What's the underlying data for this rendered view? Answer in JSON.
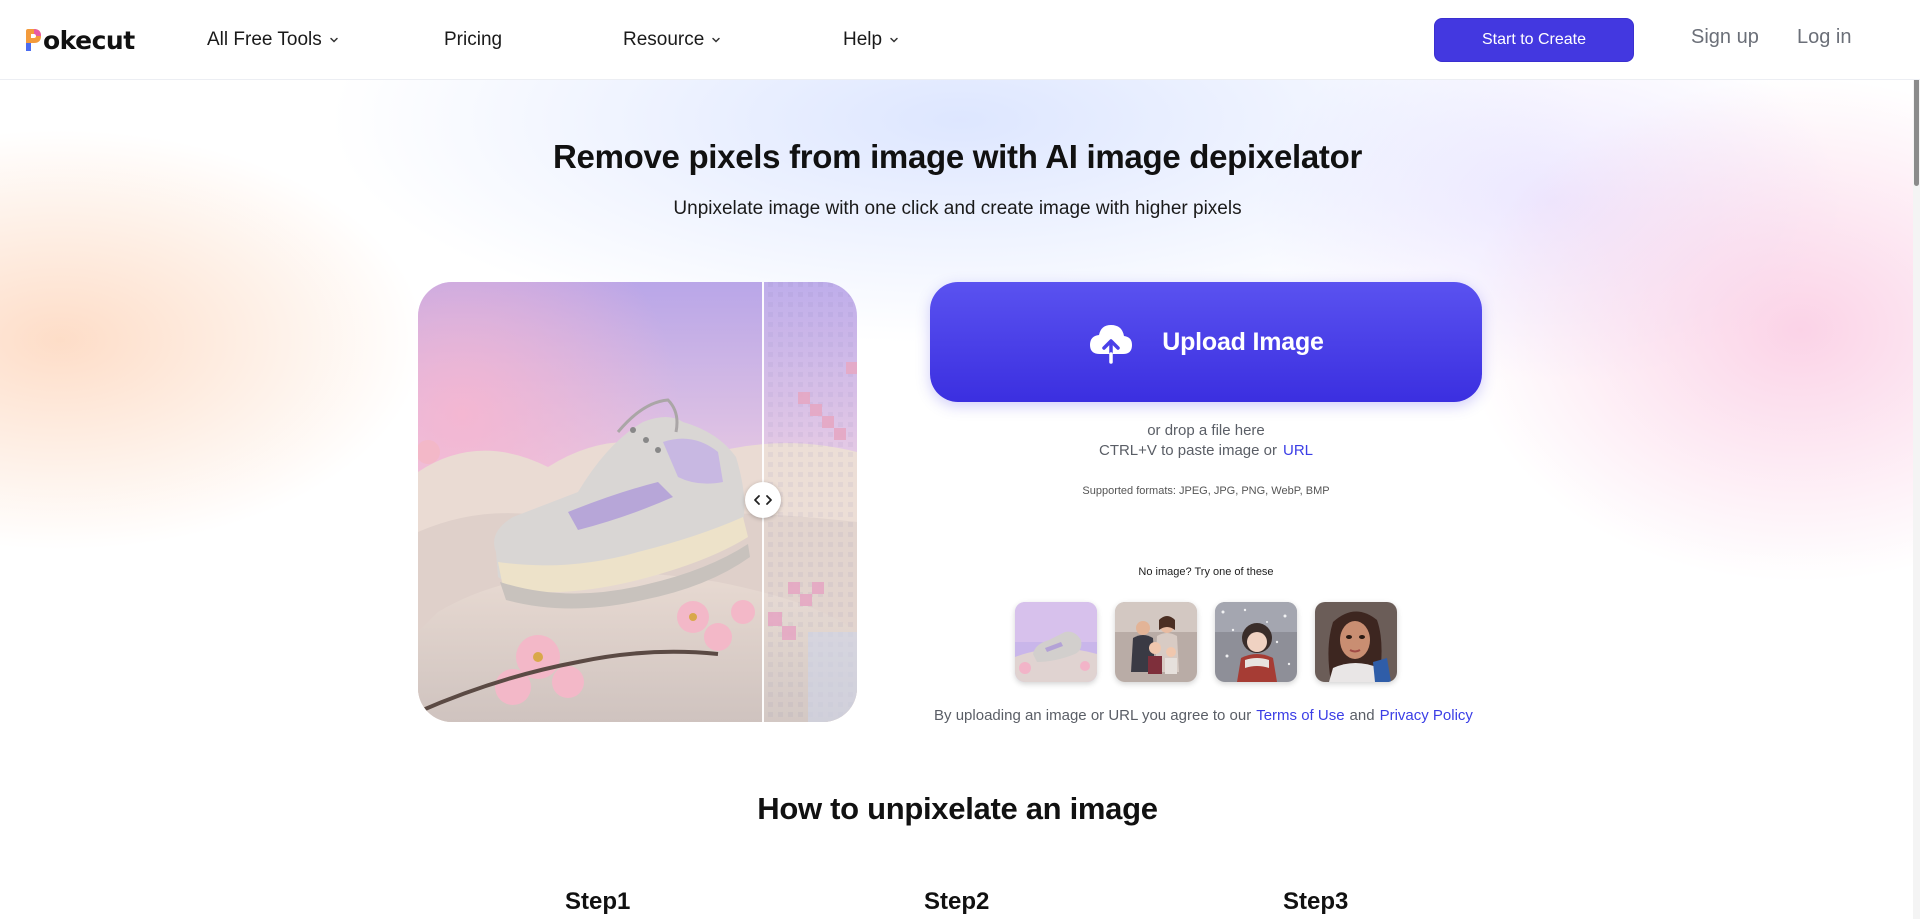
{
  "header": {
    "logo_text": "okecut",
    "nav": [
      {
        "label": "All Free Tools",
        "has_dropdown": true
      },
      {
        "label": "Pricing",
        "has_dropdown": false
      },
      {
        "label": "Resource",
        "has_dropdown": true
      },
      {
        "label": "Help",
        "has_dropdown": true
      }
    ],
    "cta_label": "Start to Create",
    "signup_label": "Sign up",
    "login_label": "Log in"
  },
  "hero": {
    "title": "Remove pixels from image with AI image depixelator",
    "subtitle": "Unpixelate image with one click and create image with higher pixels"
  },
  "upload": {
    "button_label": "Upload Image",
    "button_icon": "cloud-upload-icon",
    "drop_text": "or drop a file here",
    "paste_text": "CTRL+V to paste image or",
    "url_label": "URL",
    "formats": "Supported formats: JPEG, JPG, PNG, WebP, BMP",
    "try_text": "No image? Try one of these",
    "samples": [
      {
        "icon": "sneaker-sample-thumbnail"
      },
      {
        "icon": "family-sample-thumbnail"
      },
      {
        "icon": "anime-girl-sample-thumbnail"
      },
      {
        "icon": "woman-portrait-sample-thumbnail"
      }
    ]
  },
  "agreement": {
    "prefix": "By uploading an image or URL you agree to our",
    "terms_label": "Terms of Use",
    "and_text": "and",
    "privacy_label": "Privacy Policy"
  },
  "how_to": {
    "title": "How to unpixelate an image",
    "steps": [
      {
        "label": "Step1"
      },
      {
        "label": "Step2"
      },
      {
        "label": "Step3"
      }
    ]
  },
  "colors": {
    "brand": "#4338e0",
    "link": "#3b3ee6",
    "upload_gradient_top": "#5a52f0",
    "upload_gradient_bottom": "#3b2fe0"
  }
}
